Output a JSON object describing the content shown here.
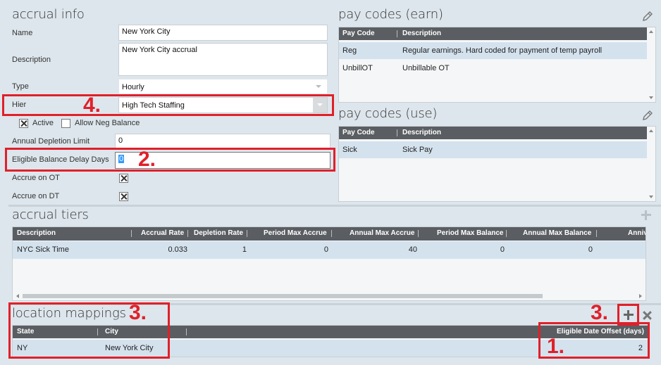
{
  "accrual_info": {
    "title": "accrual info",
    "name_label": "Name",
    "name_value": "New York City",
    "description_label": "Description",
    "description_value": "New York City accrual",
    "type_label": "Type",
    "type_value": "Hourly",
    "hier_label": "Hier",
    "hier_value": "High Tech Staffing",
    "active_label": "Active",
    "active_checked": true,
    "allow_neg_label": "Allow Neg Balance",
    "allow_neg_checked": false,
    "annual_depletion_label": "Annual Depletion Limit",
    "annual_depletion_value": "0",
    "eligible_delay_label": "Eligible Balance Delay Days",
    "eligible_delay_value": "0",
    "accrue_ot_label": "Accrue on OT",
    "accrue_dt_label": "Accrue on DT"
  },
  "pay_codes_earn": {
    "title": "pay codes (earn)",
    "columns": [
      "Pay Code",
      "Description"
    ],
    "rows": [
      {
        "code": "Reg",
        "description": "Regular earnings.  Hard coded for payment of temp payroll"
      },
      {
        "code": "UnbillOT",
        "description": "Unbillable OT"
      }
    ]
  },
  "pay_codes_use": {
    "title": "pay codes (use)",
    "columns": [
      "Pay Code",
      "Description"
    ],
    "rows": [
      {
        "code": "Sick",
        "description": "Sick Pay"
      }
    ]
  },
  "accrual_tiers": {
    "title": "accrual tiers",
    "columns": [
      "Description",
      "Accrual Rate",
      "Depletion Rate",
      "Period Max Accrue",
      "Annual Max Accrue",
      "Period Max Balance",
      "Annual Max Balance",
      "Anniv"
    ],
    "rows": [
      {
        "description": "NYC Sick Time",
        "accrual_rate": "0.033",
        "depletion_rate": "1",
        "period_max_accrue": "0",
        "annual_max_accrue": "40",
        "period_max_balance": "0",
        "annual_max_balance": "0"
      }
    ]
  },
  "location_mappings": {
    "title": "location mappings",
    "columns": [
      "State",
      "City",
      "Eligible Date Offset (days)"
    ],
    "rows": [
      {
        "state": "NY",
        "city": "New York City",
        "offset": "2"
      }
    ]
  },
  "callouts": {
    "c1": "1.",
    "c2": "2.",
    "c3a": "3.",
    "c3b": "3.",
    "c4": "4."
  },
  "colors": {
    "highlight": "#e0202a",
    "grid_header": "#5a5e62",
    "selected_row": "#d4e2ee"
  }
}
